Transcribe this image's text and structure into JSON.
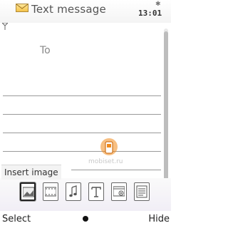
{
  "header": {
    "title": "Text message",
    "clock": "13:01",
    "bluetooth_icon": "bluetooth-icon",
    "signal_icon": "antenna-icon",
    "message_icon": "envelope-icon"
  },
  "editor": {
    "to_label": "To"
  },
  "watermark": {
    "text": "mobiset.ru"
  },
  "toolbar": {
    "tooltip": "Insert image",
    "items": [
      {
        "icon": "image-icon",
        "selected": true
      },
      {
        "icon": "video-clip-icon"
      },
      {
        "icon": "music-note-icon"
      },
      {
        "icon": "text-template-icon"
      },
      {
        "icon": "presentation-icon"
      },
      {
        "icon": "note-icon"
      }
    ]
  },
  "softkeys": {
    "left": "Select",
    "right": "Hide"
  },
  "colors": {
    "accent": "#f08a1c",
    "rule": "#9a9a9a",
    "text": "#222222"
  }
}
